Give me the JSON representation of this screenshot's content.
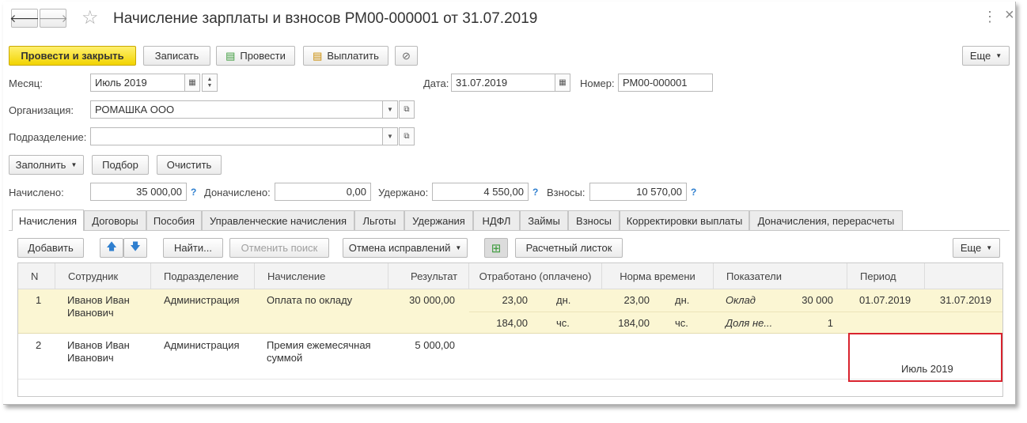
{
  "header": {
    "title": "Начисление зарплаты и взносов РМ00-000001 от 31.07.2019",
    "back_glyph": "🡐",
    "forward_glyph": "🡒",
    "star_glyph": "☆",
    "more_glyph": "⋮",
    "close_glyph": "×"
  },
  "toolbar": {
    "post_close": "Провести и закрыть",
    "save": "Записать",
    "post": "Провести",
    "pay": "Выплатить",
    "more": "Еще",
    "post_icon_glyph": "▤",
    "pay_icon_glyph": "▤",
    "attach_icon_glyph": "⊘"
  },
  "form": {
    "month_label": "Месяц:",
    "month_value": "Июль 2019",
    "date_label": "Дата:",
    "date_value": "31.07.2019",
    "number_label": "Номер:",
    "number_value": "РМ00-000001",
    "org_label": "Организация:",
    "org_value": "РОМАШКА ООО",
    "dept_label": "Подразделение:",
    "dept_value": ""
  },
  "actions": {
    "fill": "Заполнить",
    "select": "Подбор",
    "clear": "Очистить"
  },
  "totals": {
    "accrued_label": "Начислено:",
    "accrued_value": "35 000,00",
    "additional_label": "Доначислено:",
    "additional_value": "0,00",
    "withheld_label": "Удержано:",
    "withheld_value": "4 550,00",
    "contrib_label": "Взносы:",
    "contrib_value": "10 570,00",
    "help_glyph": "?"
  },
  "tabs": [
    "Начисления",
    "Договоры",
    "Пособия",
    "Управленческие начисления",
    "Льготы",
    "Удержания",
    "НДФЛ",
    "Займы",
    "Взносы",
    "Корректировки выплаты",
    "Доначисления, перерасчеты"
  ],
  "table_toolbar": {
    "add": "Добавить",
    "up_glyph": "🡅",
    "down_glyph": "🡇",
    "find": "Найти...",
    "cancel_search": "Отменить поиск",
    "undo_corrections": "Отмена исправлений",
    "table_icon_glyph": "⊞",
    "payslip": "Расчетный листок",
    "more": "Еще"
  },
  "table": {
    "columns": [
      "N",
      "Сотрудник",
      "Подразделение",
      "Начисление",
      "Результат",
      "Отработано (оплачено)",
      "Норма времени",
      "Показатели",
      "Период"
    ],
    "rows": [
      {
        "n": "1",
        "employee_1": "Иванов Иван",
        "employee_2": "Иванович",
        "dept": "Администрация",
        "accrual_1": "Оплата по окладу",
        "accrual_2": "",
        "result": "30 000,00",
        "worked_days": "23,00",
        "worked_days_unit": "дн.",
        "worked_hours": "184,00",
        "worked_hours_unit": "чс.",
        "norm_days": "23,00",
        "norm_days_unit": "дн.",
        "norm_hours": "184,00",
        "norm_hours_unit": "чс.",
        "indicator_1": "Оклад",
        "indicator_1_value": "30 000",
        "indicator_2": "Доля не...",
        "indicator_2_value": "1",
        "period_from": "01.07.2019",
        "period_to": "31.07.2019"
      },
      {
        "n": "2",
        "employee_1": "Иванов Иван",
        "employee_2": "Иванович",
        "dept": "Администрация",
        "accrual_1": "Премия ежемесячная",
        "accrual_2": "суммой",
        "result": "5 000,00",
        "period_month": "Июль 2019"
      }
    ]
  },
  "colors": {
    "primary_button": "#f2d400",
    "selected_row": "#fbf6d3",
    "highlight_frame": "#d9232e",
    "help_mark": "#2f7fcf"
  }
}
